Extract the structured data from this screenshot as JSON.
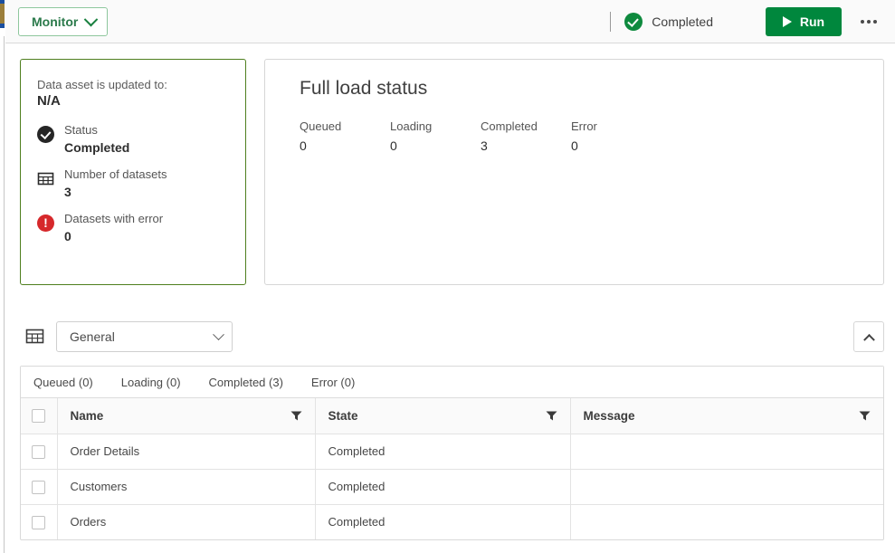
{
  "header": {
    "monitor_button": "Monitor",
    "status_text": "Completed",
    "run_button": "Run",
    "more_menu": "more-options"
  },
  "summary_card": {
    "updated_label": "Data asset is updated to:",
    "updated_value": "N/A",
    "stats": [
      {
        "icon": "check-circle-icon",
        "label": "Status",
        "value": "Completed"
      },
      {
        "icon": "grid-table-icon",
        "label": "Number of datasets",
        "value": "3"
      },
      {
        "icon": "error-circle-icon",
        "label": "Datasets with error",
        "value": "0"
      }
    ]
  },
  "load_panel": {
    "title": "Full load status",
    "stats": [
      {
        "label": "Queued",
        "value": "0"
      },
      {
        "label": "Loading",
        "value": "0"
      },
      {
        "label": "Completed",
        "value": "3"
      },
      {
        "label": "Error",
        "value": "0"
      }
    ]
  },
  "selector": {
    "icon": "grid-table-icon",
    "selected": "General",
    "collapse_icon": "chevron-up-icon"
  },
  "tabs": [
    {
      "label": "Queued (0)"
    },
    {
      "label": "Loading (0)"
    },
    {
      "label": "Completed (3)"
    },
    {
      "label": "Error (0)"
    }
  ],
  "table": {
    "columns": [
      {
        "label": "Name"
      },
      {
        "label": "State"
      },
      {
        "label": "Message"
      }
    ],
    "rows": [
      {
        "name": "Order Details",
        "state": "Completed",
        "message": ""
      },
      {
        "name": "Customers",
        "state": "Completed",
        "message": ""
      },
      {
        "name": "Orders",
        "state": "Completed",
        "message": ""
      }
    ]
  },
  "colors": {
    "brand_green": "#00873d",
    "status_green": "#0e8a3e",
    "card_border_green": "#4e7f1e",
    "error_red": "#d6282b"
  }
}
